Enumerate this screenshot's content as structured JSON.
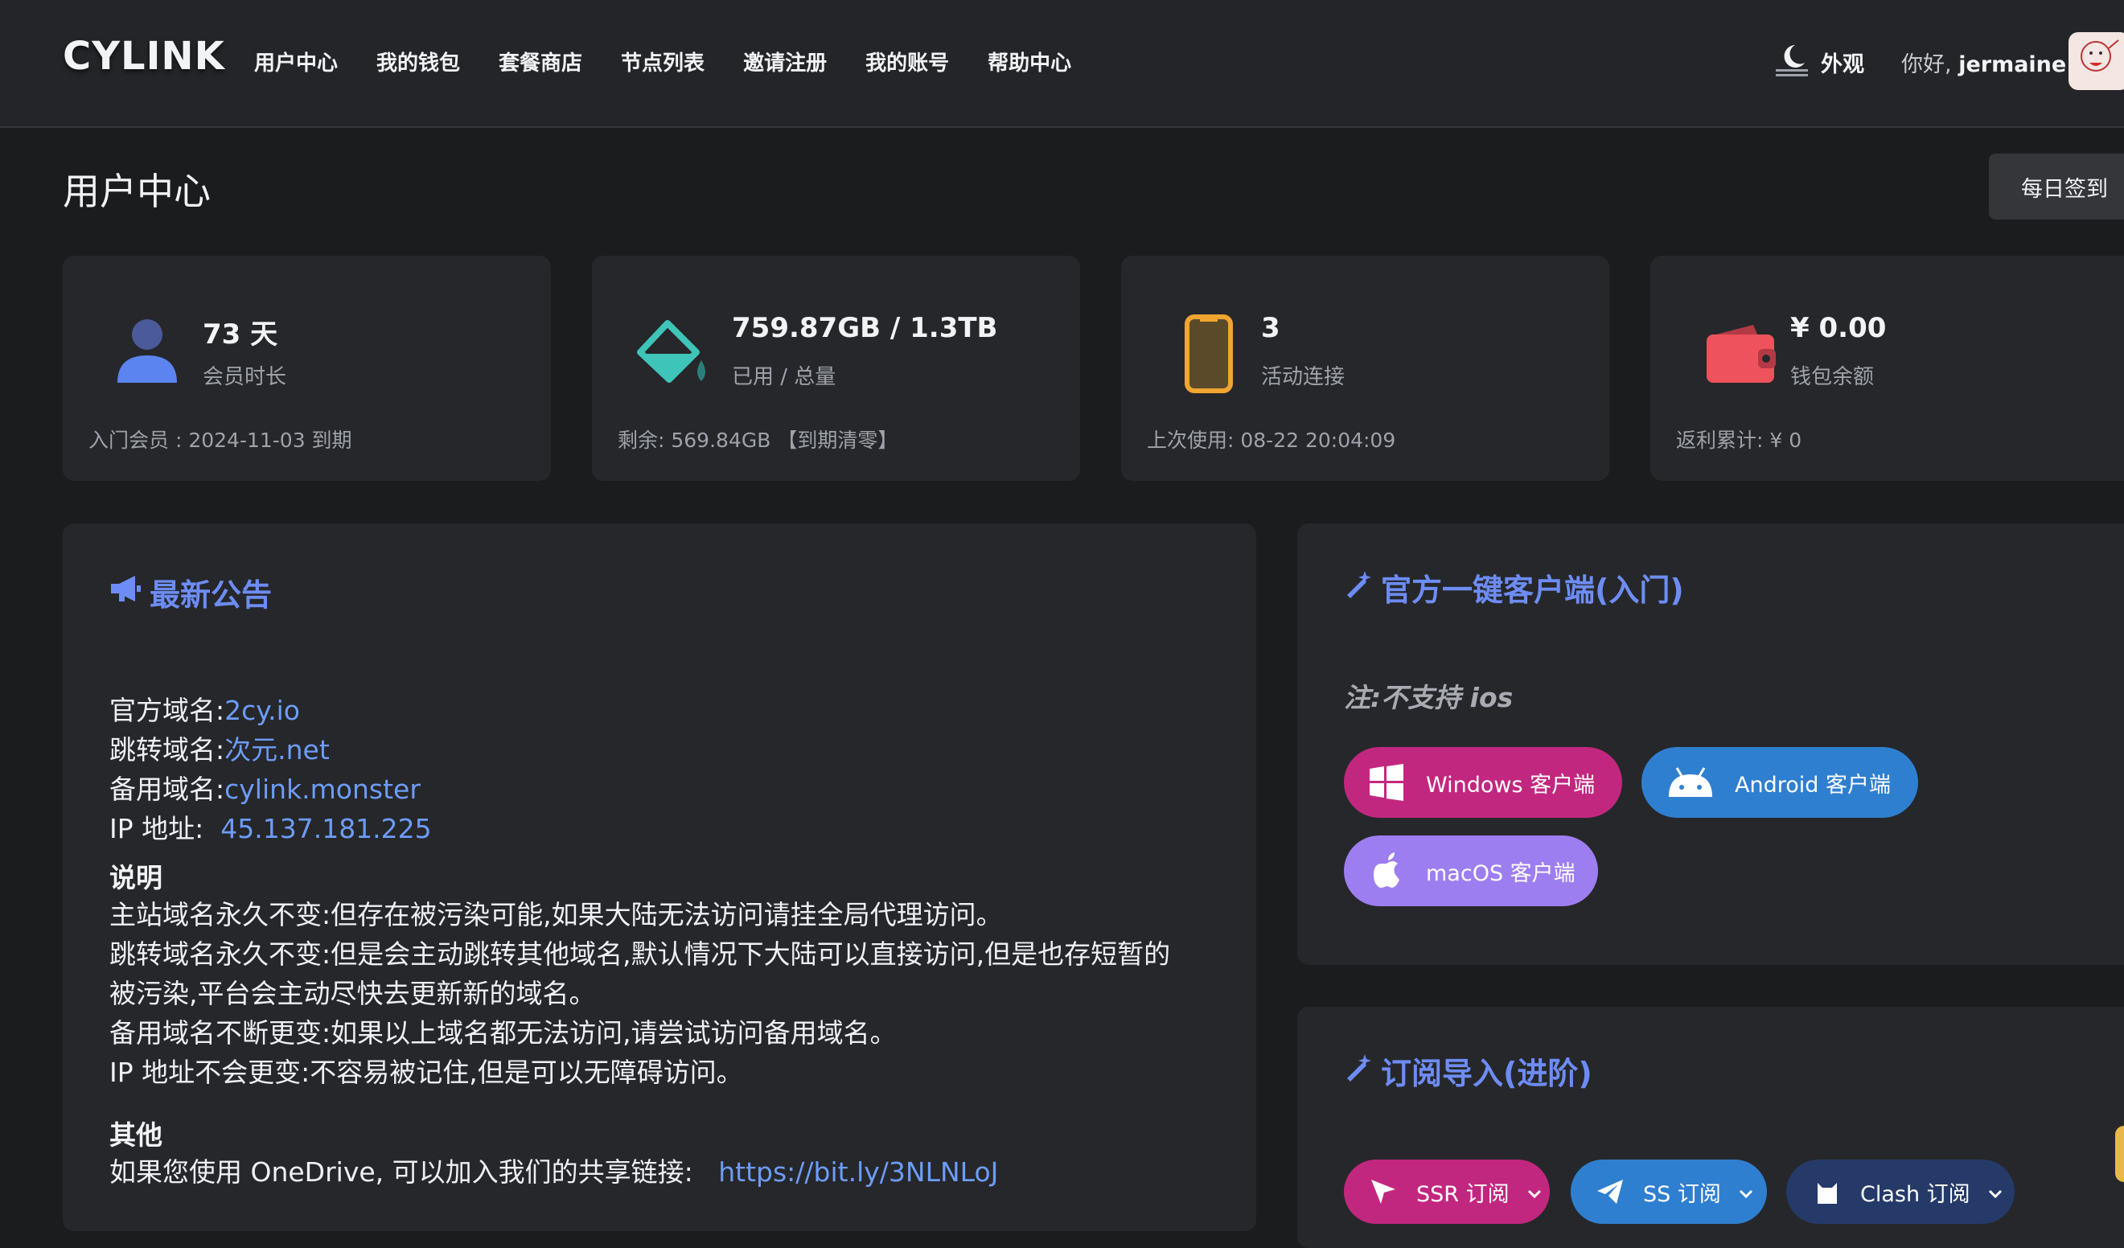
{
  "header": {
    "logo": "CYLINK",
    "nav": [
      "用户中心",
      "我的钱包",
      "套餐商店",
      "节点列表",
      "邀请注册",
      "我的账号",
      "帮助中心"
    ],
    "appearance_label": "外观",
    "greeting_prefix": "你好,",
    "username": "jermaine"
  },
  "page": {
    "title": "用户中心",
    "checkin_label": "每日签到"
  },
  "stats": [
    {
      "value": "73 天",
      "label": "会员时长",
      "foot": "入门会员 : 2024-11-03 到期",
      "icon": "user-icon"
    },
    {
      "value": "759.87GB / 1.3TB",
      "label": "已用 / 总量",
      "foot": "剩余:  569.84GB 【到期清零】",
      "icon": "paint-bucket-icon"
    },
    {
      "value": "3",
      "label": "活动连接",
      "foot": "上次使用: 08-22 20:04:09",
      "icon": "phone-icon"
    },
    {
      "value": "¥ 0.00",
      "label": "钱包余额",
      "foot": "返利累计: ¥ 0",
      "icon": "wallet-icon"
    }
  ],
  "announcement": {
    "title": "最新公告",
    "domains": [
      {
        "label": "官方域名:",
        "value": "2cy.io"
      },
      {
        "label": "跳转域名:",
        "value": "次元.net"
      },
      {
        "label": "备用域名:",
        "value": "cylink.monster"
      },
      {
        "label": "IP 地址: ",
        "value": "45.137.181.225"
      }
    ],
    "explain_heading": "说明",
    "explain_lines": [
      "主站域名永久不变:但存在被污染可能,如果大陆无法访问请挂全局代理访问。",
      "跳转域名永久不变:但是会主动跳转其他域名,默认情况下大陆可以直接访问,但是也存短暂的",
      "被污染,平台会主动尽快去更新新的域名。",
      "备用域名不断更变:如果以上域名都无法访问,请尝试访问备用域名。",
      "IP 地址不会更变:不容易被记住,但是可以无障碍访问。"
    ],
    "other_heading": "其他",
    "other_text": "如果您使用 OneDrive, 可以加入我们的共享链接:",
    "other_link": "https://bit.ly/3NLNLoJ"
  },
  "client_panel": {
    "title": "官方一键客户端(入门)",
    "note": "注:不支持 ios",
    "buttons": [
      {
        "label": "Windows 客户端",
        "color": "#c2277f"
      },
      {
        "label": "Android 客户端",
        "color": "#2f7fd0"
      },
      {
        "label": "macOS 客户端",
        "color": "#9d7ef0"
      }
    ]
  },
  "subscribe_panel": {
    "title": "订阅导入(进阶)",
    "buttons": [
      {
        "label": "SSR 订阅",
        "color": "#c2277f"
      },
      {
        "label": "SS 订阅",
        "color": "#2f7fd0"
      },
      {
        "label": "Clash 订阅",
        "color": "#253a68"
      }
    ]
  }
}
